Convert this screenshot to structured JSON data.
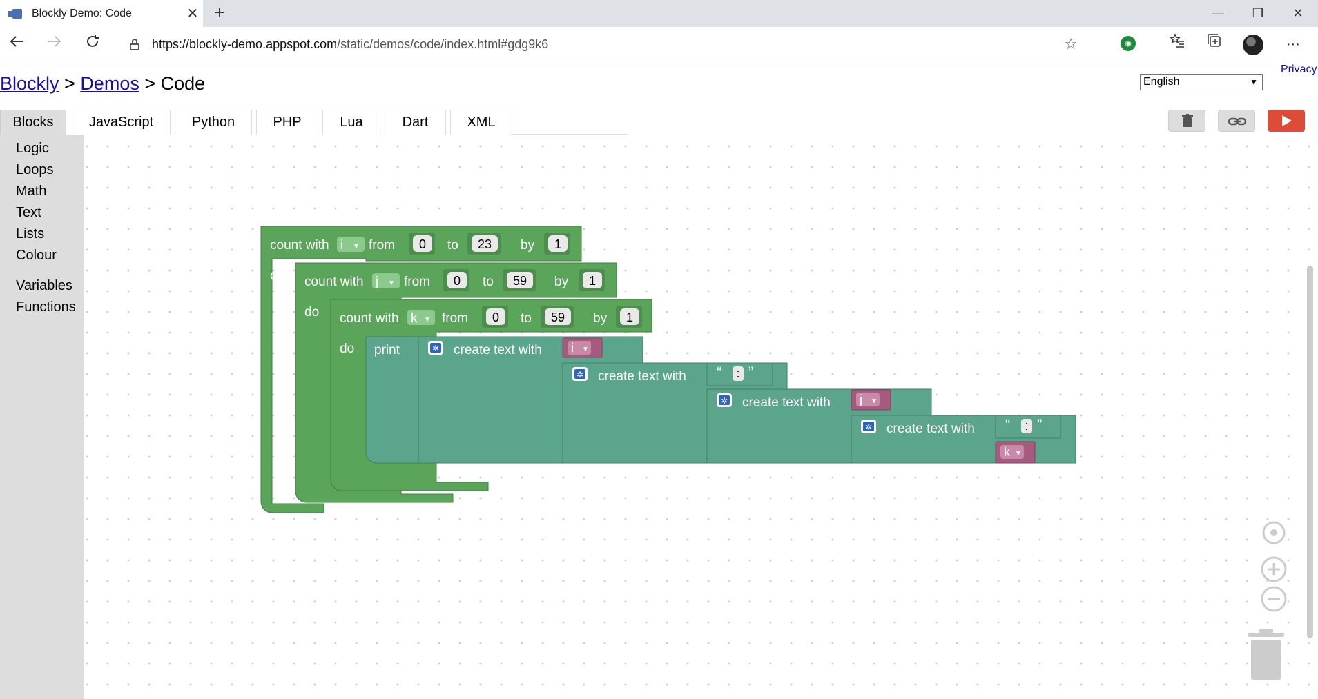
{
  "browser": {
    "tab_title": "Blockly Demo: Code",
    "tab_close": "✕",
    "new_tab": "+",
    "url_host": "https://blockly-demo.appspot.com",
    "url_path": "/static/demos/code/index.html#gdg9k6",
    "window": {
      "minimize": "—",
      "restore": "❐",
      "close": "✕"
    }
  },
  "page": {
    "privacy_link": "Privacy",
    "breadcrumb": {
      "root": "Blockly",
      "sep1": " > ",
      "demos": "Demos",
      "sep2": " > ",
      "current": "Code"
    },
    "language_select": "English"
  },
  "code_tabs": [
    "Blocks",
    "JavaScript",
    "Python",
    "PHP",
    "Lua",
    "Dart",
    "XML"
  ],
  "toolbox": {
    "categories": [
      "Logic",
      "Loops",
      "Math",
      "Text",
      "Lists",
      "Colour"
    ],
    "categories2": [
      "Variables",
      "Functions"
    ]
  },
  "blocks": {
    "loop_i": {
      "label": "count with",
      "var": "i",
      "from_label": "from",
      "from": "0",
      "to_label": "to",
      "to": "23",
      "by_label": "by",
      "by": "1",
      "do": "do"
    },
    "loop_j": {
      "label": "count with",
      "var": "j",
      "from_label": "from",
      "from": "0",
      "to_label": "to",
      "to": "59",
      "by_label": "by",
      "by": "1",
      "do": "do"
    },
    "loop_k": {
      "label": "count with",
      "var": "k",
      "from_label": "from",
      "from": "0",
      "to_label": "to",
      "to": "59",
      "by_label": "by",
      "by": "1",
      "do": "do"
    },
    "print": "print",
    "create_text_with": "create text with",
    "text_open_quote": "“",
    "text_close_quote": "”",
    "colon": ":",
    "var_i": "i",
    "var_j": "j",
    "var_k": "k"
  },
  "colors": {
    "loop_block": "#5ba55b",
    "text_block": "#5ba58c",
    "variable_block": "#a55b80",
    "run_button": "#dd4b39"
  }
}
